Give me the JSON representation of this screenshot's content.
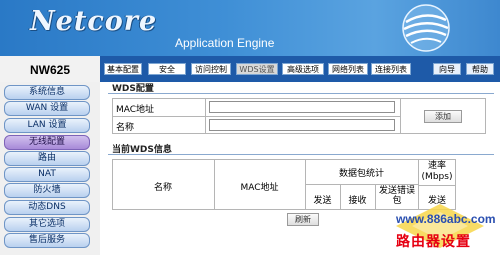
{
  "header": {
    "logo_text": "Netcore",
    "subtitle": "Application Engine"
  },
  "device": {
    "model": "NW625"
  },
  "tabs": [
    {
      "label": "基本配置",
      "active": false
    },
    {
      "label": "安全",
      "active": false
    },
    {
      "label": "访问控制",
      "active": false
    },
    {
      "label": "WDS设置",
      "active": true
    },
    {
      "label": "高级选项",
      "active": false
    },
    {
      "label": "网络列表",
      "active": false
    },
    {
      "label": "连接列表",
      "active": false
    }
  ],
  "utility_tabs": [
    {
      "label": "向导"
    },
    {
      "label": "帮助"
    }
  ],
  "sidebar": {
    "items": [
      {
        "label": "系统信息",
        "active": false
      },
      {
        "label": "WAN 设置",
        "active": false
      },
      {
        "label": "LAN 设置",
        "active": false
      },
      {
        "label": "无线配置",
        "active": true
      },
      {
        "label": "路由",
        "active": false
      },
      {
        "label": "NAT",
        "active": false
      },
      {
        "label": "防火墙",
        "active": false
      },
      {
        "label": "动态DNS",
        "active": false
      },
      {
        "label": "其它选项",
        "active": false
      },
      {
        "label": "售后服务",
        "active": false
      }
    ]
  },
  "wds_config": {
    "title": "WDS配置",
    "mac_label": "MAC地址",
    "mac_value": "",
    "name_label": "名称",
    "name_value": "",
    "add_button": "添加"
  },
  "wds_info": {
    "title": "当前WDS信息",
    "columns": {
      "name": "名称",
      "mac": "MAC地址",
      "packet_stats": "数据包统计",
      "send": "发送",
      "receive": "接收",
      "send_error": "发送错误包",
      "rate": "速率(Mbps)",
      "rate_send": "发送"
    },
    "refresh_button": "刷新"
  },
  "watermark": {
    "url": "www.886abc.com",
    "text": "路由器设置"
  },
  "colors": {
    "banner": "#3f8fd6",
    "tab_bar": "#1e5aa8",
    "sidebar_active": "#a78ad8",
    "watermark_red": "#e60012"
  }
}
